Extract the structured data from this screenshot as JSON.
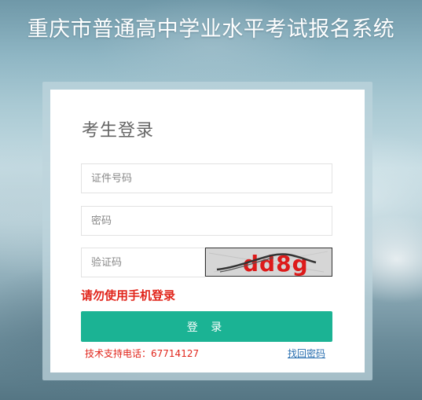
{
  "header": {
    "title": "重庆市普通高中学业水平考试报名系统"
  },
  "login": {
    "heading": "考生登录",
    "id_placeholder": "证件号码",
    "password_placeholder": "密码",
    "captcha_placeholder": "验证码",
    "captcha_text": "dd8g",
    "mobile_hint": "请勿使用手机登录",
    "submit_label": "登 录",
    "support_label": "技术支持电话：",
    "support_phone": "67714127",
    "forgot_label": "找回密码"
  },
  "colors": {
    "accent": "#1bb394",
    "warning": "#e1251b",
    "link": "#2a6fb0"
  }
}
